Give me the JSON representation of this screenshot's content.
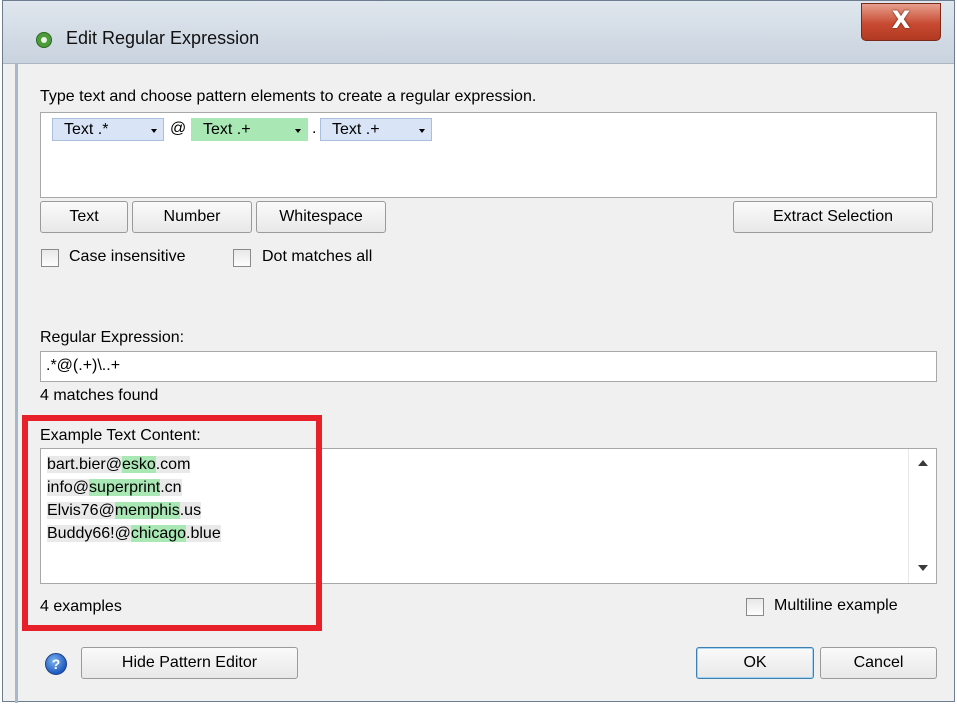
{
  "window": {
    "title": "Edit Regular Expression",
    "close_label": "X"
  },
  "pattern_editor": {
    "instruction": "Type text and choose pattern elements to create a regular expression.",
    "tokens": [
      {
        "label": "Text .*",
        "style": "blue"
      },
      {
        "label": "Text .+",
        "style": "green"
      },
      {
        "label": "Text .+",
        "style": "blue"
      }
    ],
    "separators": [
      "@",
      "."
    ],
    "buttons": {
      "text": "Text",
      "number": "Number",
      "whitespace": "Whitespace",
      "extract": "Extract Selection"
    },
    "options": {
      "case_insensitive": "Case insensitive",
      "dot_matches_all": "Dot matches all"
    }
  },
  "regex": {
    "label": "Regular Expression:",
    "value": ".*@(.+)\\..+",
    "match_status": "4 matches found"
  },
  "examples": {
    "label": "Example Text Content:",
    "lines": [
      {
        "pre": "bart.bier@",
        "match": "esko",
        "post": ".com"
      },
      {
        "pre": "info@",
        "match": "superprint",
        "post": ".cn"
      },
      {
        "pre": "Elvis76@",
        "match": "memphis",
        "post": ".us"
      },
      {
        "pre": "Buddy66!@",
        "match": "chicago",
        "post": ".blue"
      }
    ],
    "count": "4 examples",
    "multiline_label": "Multiline example"
  },
  "footer": {
    "help_icon": "?",
    "hide_pattern_editor": "Hide Pattern Editor",
    "ok": "OK",
    "cancel": "Cancel"
  },
  "colors": {
    "token_blue": "#d9e5f7",
    "token_green": "#a9e7b4",
    "highlight_frame": "#e8202a"
  }
}
